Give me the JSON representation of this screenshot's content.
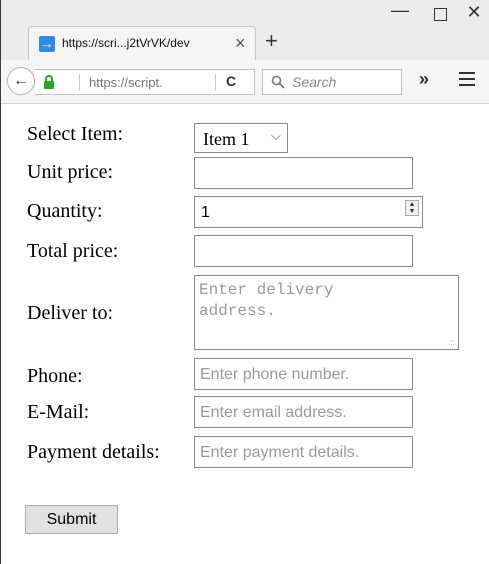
{
  "browser": {
    "tab_title": "https://scri...j2tVrVK/dev",
    "url": "https://script.",
    "search_placeholder": "Search",
    "overflow_label": "»",
    "new_tab_label": "+",
    "tab_close_label": "×"
  },
  "form": {
    "select_item": {
      "label": "Select Item:",
      "value": "Item 1"
    },
    "unit_price": {
      "label": "Unit price:",
      "value": ""
    },
    "quantity": {
      "label": "Quantity:",
      "value": "1"
    },
    "total_price": {
      "label": "Total price:",
      "value": ""
    },
    "deliver_to": {
      "label": "Deliver to:",
      "placeholder": "Enter delivery address."
    },
    "phone": {
      "label": "Phone:",
      "placeholder": "Enter phone number."
    },
    "email": {
      "label": "E-Mail:",
      "placeholder": "Enter email address."
    },
    "payment": {
      "label": "Payment details:",
      "placeholder": "Enter payment details."
    },
    "submit_label": "Submit"
  }
}
